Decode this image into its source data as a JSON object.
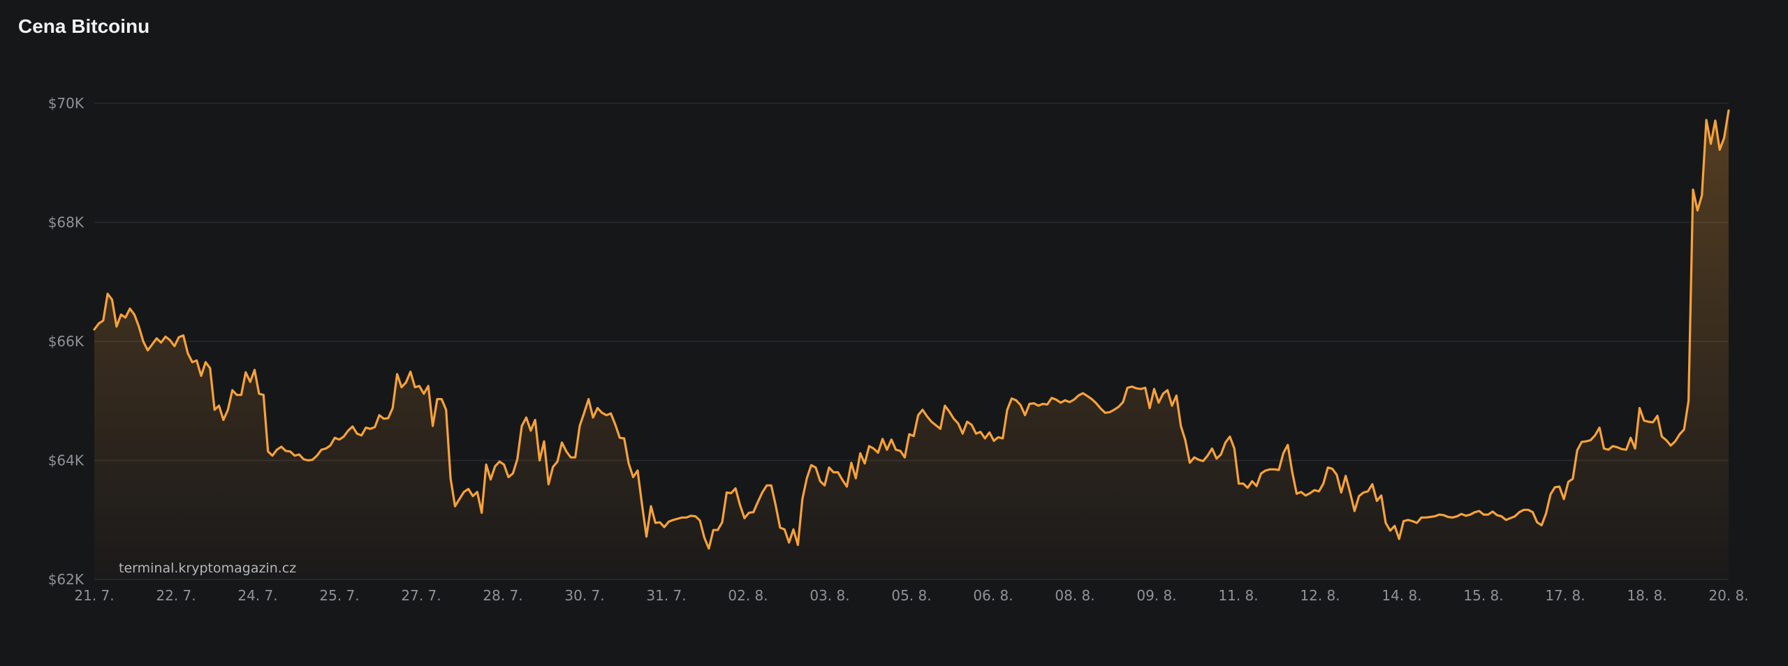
{
  "chart_data": {
    "type": "area",
    "title": "Cena Bitcoinu",
    "watermark": "terminal.kryptomagazin.cz",
    "line_color": "#f7a23b",
    "ylim": [
      62000,
      70000
    ],
    "y_ticks": [
      {
        "value": 70000,
        "label": "$70K"
      },
      {
        "value": 68000,
        "label": "$68K"
      },
      {
        "value": 66000,
        "label": "$66K"
      },
      {
        "value": 64000,
        "label": "$64K"
      },
      {
        "value": 62000,
        "label": "$62K"
      }
    ],
    "grid": true,
    "x_ticks": [
      "21. 7.",
      "22. 7.",
      "24. 7.",
      "25. 7.",
      "27. 7.",
      "28. 7.",
      "30. 7.",
      "31. 7.",
      "02. 8.",
      "03. 8.",
      "05. 8.",
      "06. 8.",
      "08. 8.",
      "09. 8.",
      "11. 8.",
      "12. 8.",
      "14. 8.",
      "15. 8.",
      "17. 8.",
      "18. 8.",
      "20. 8."
    ],
    "values": [
      66200,
      66300,
      66350,
      66800,
      66700,
      66250,
      66450,
      66400,
      66550,
      66450,
      66250,
      66000,
      65850,
      65950,
      66050,
      65980,
      66080,
      66020,
      65920,
      66070,
      66100,
      65800,
      65650,
      65680,
      65420,
      65650,
      65550,
      64850,
      64920,
      64680,
      64850,
      65180,
      65100,
      65100,
      65480,
      65320,
      65520,
      65120,
      65100,
      64150,
      64080,
      64180,
      64230,
      64160,
      64150,
      64080,
      64100,
      64020,
      64000,
      64010,
      64080,
      64180,
      64200,
      64250,
      64380,
      64350,
      64400,
      64500,
      64570,
      64450,
      64420,
      64550,
      64530,
      64560,
      64760,
      64700,
      64710,
      64880,
      65450,
      65230,
      65310,
      65490,
      65230,
      65250,
      65120,
      65250,
      64580,
      65030,
      65030,
      64850,
      63700,
      63230,
      63350,
      63470,
      63520,
      63400,
      63470,
      63120,
      63930,
      63680,
      63900,
      63980,
      63930,
      63720,
      63780,
      64020,
      64580,
      64720,
      64500,
      64680,
      64000,
      64320,
      63600,
      63890,
      63980,
      64300,
      64150,
      64050,
      64050,
      64580,
      64800,
      65030,
      64720,
      64880,
      64800,
      64760,
      64790,
      64600,
      64380,
      64370,
      63950,
      63720,
      63830,
      63250,
      62720,
      63230,
      62950,
      62960,
      62880,
      62970,
      63000,
      63020,
      63040,
      63040,
      63070,
      63060,
      62990,
      62700,
      62520,
      62830,
      62830,
      62960,
      63460,
      63450,
      63530,
      63250,
      63030,
      63120,
      63130,
      63300,
      63460,
      63580,
      63580,
      63250,
      62870,
      62840,
      62620,
      62840,
      62580,
      63350,
      63700,
      63920,
      63880,
      63650,
      63580,
      63880,
      63800,
      63800,
      63670,
      63560,
      63960,
      63700,
      64120,
      63950,
      64240,
      64200,
      64130,
      64360,
      64180,
      64350,
      64180,
      64160,
      64050,
      64440,
      64410,
      64760,
      64850,
      64740,
      64650,
      64590,
      64530,
      64920,
      64820,
      64700,
      64620,
      64450,
      64650,
      64600,
      64450,
      64480,
      64370,
      64470,
      64330,
      64390,
      64370,
      64850,
      65040,
      65010,
      64930,
      64760,
      64950,
      64960,
      64920,
      64950,
      64940,
      65050,
      65020,
      64970,
      65010,
      64980,
      65020,
      65090,
      65130,
      65080,
      65030,
      64960,
      64870,
      64800,
      64810,
      64850,
      64900,
      64980,
      65220,
      65240,
      65210,
      65200,
      65220,
      64880,
      65200,
      64970,
      65120,
      65180,
      64920,
      65090,
      64580,
      64340,
      63960,
      64050,
      64010,
      63990,
      64080,
      64200,
      64030,
      64100,
      64300,
      64400,
      64200,
      63610,
      63610,
      63540,
      63650,
      63570,
      63780,
      63830,
      63850,
      63850,
      63840,
      64120,
      64260,
      63810,
      63440,
      63470,
      63410,
      63450,
      63500,
      63480,
      63610,
      63880,
      63860,
      63760,
      63460,
      63740,
      63460,
      63150,
      63400,
      63460,
      63480,
      63600,
      63320,
      63410,
      62950,
      62820,
      62900,
      62680,
      62980,
      63000,
      62980,
      62950,
      63040,
      63040,
      63050,
      63060,
      63090,
      63080,
      63050,
      63040,
      63060,
      63100,
      63070,
      63090,
      63130,
      63150,
      63090,
      63090,
      63140,
      63080,
      63060,
      63000,
      63030,
      63060,
      63130,
      63170,
      63170,
      63130,
      62960,
      62910,
      63110,
      63430,
      63550,
      63560,
      63350,
      63640,
      63690,
      64170,
      64310,
      64320,
      64340,
      64420,
      64550,
      64200,
      64180,
      64240,
      64220,
      64190,
      64180,
      64380,
      64200,
      64880,
      64670,
      64650,
      64640,
      64750,
      64400,
      64340,
      64250,
      64320,
      64440,
      64520,
      65000,
      68550,
      68200,
      68450,
      69720,
      69320,
      69710,
      69220,
      69420,
      69880
    ]
  }
}
